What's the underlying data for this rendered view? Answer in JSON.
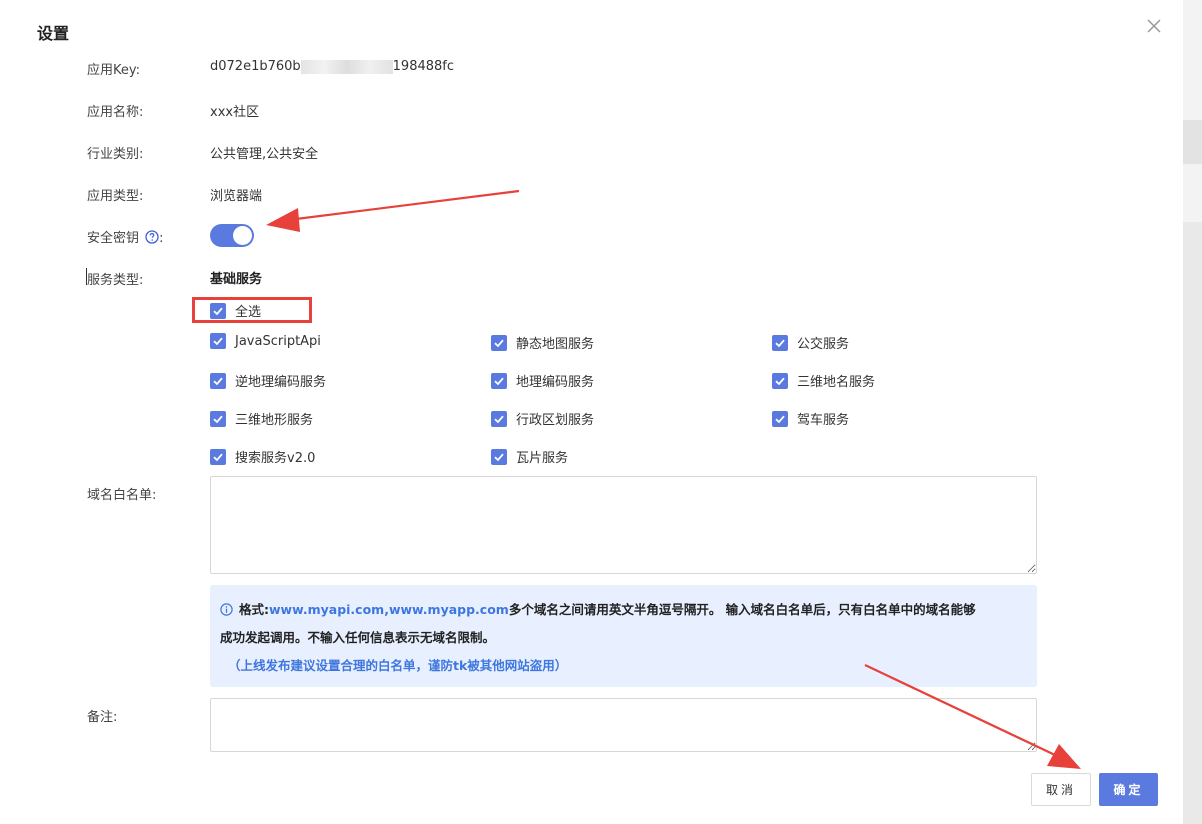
{
  "dialog": {
    "title": "设置"
  },
  "fields": {
    "app_key": {
      "label": "应用Key:",
      "value_prefix": "d072e1b760b",
      "value_suffix": "198488fc"
    },
    "app_name": {
      "label": "应用名称:",
      "value": "xxx社区"
    },
    "industry": {
      "label": "行业类别:",
      "value": "公共管理,公共安全"
    },
    "app_type": {
      "label": "应用类型:",
      "value": "浏览器端"
    },
    "security_key": {
      "label": "安全密钥",
      "colon": ":",
      "enabled": true
    },
    "service_type": {
      "label": "服务类型:",
      "section_title": "基础服务"
    },
    "whitelist": {
      "label": "域名白名单:",
      "value": ""
    },
    "note": {
      "label": "备注:",
      "value": ""
    }
  },
  "services": {
    "select_all": {
      "label": "全选",
      "checked": true
    },
    "items": [
      {
        "label": "JavaScriptApi",
        "checked": true
      },
      {
        "label": "静态地图服务",
        "checked": true
      },
      {
        "label": "公交服务",
        "checked": true
      },
      {
        "label": "逆地理编码服务",
        "checked": true
      },
      {
        "label": "地理编码服务",
        "checked": true
      },
      {
        "label": "三维地名服务",
        "checked": true
      },
      {
        "label": "三维地形服务",
        "checked": true
      },
      {
        "label": "行政区划服务",
        "checked": true
      },
      {
        "label": "驾车服务",
        "checked": true
      },
      {
        "label": "搜索服务v2.0",
        "checked": true
      },
      {
        "label": "瓦片服务",
        "checked": true
      }
    ]
  },
  "info": {
    "format_label": "格式:",
    "format_example": "www.myapi.com,www.myapp.com",
    "line1_rest": "多个域名之间请用英文半角逗号隔开。 输入域名白名单后，只有白名单中的域名能够",
    "line2": "成功发起调用。不输入任何信息表示无域名限制。",
    "tip": "（上线发布建议设置合理的白名单，谨防tk被其他网站盗用）"
  },
  "buttons": {
    "cancel": "取消",
    "ok": "确定"
  },
  "colors": {
    "primary": "#5b7ae0",
    "annotation": "#e8403a",
    "info_bg": "#e8efff",
    "link": "#3e77df"
  }
}
